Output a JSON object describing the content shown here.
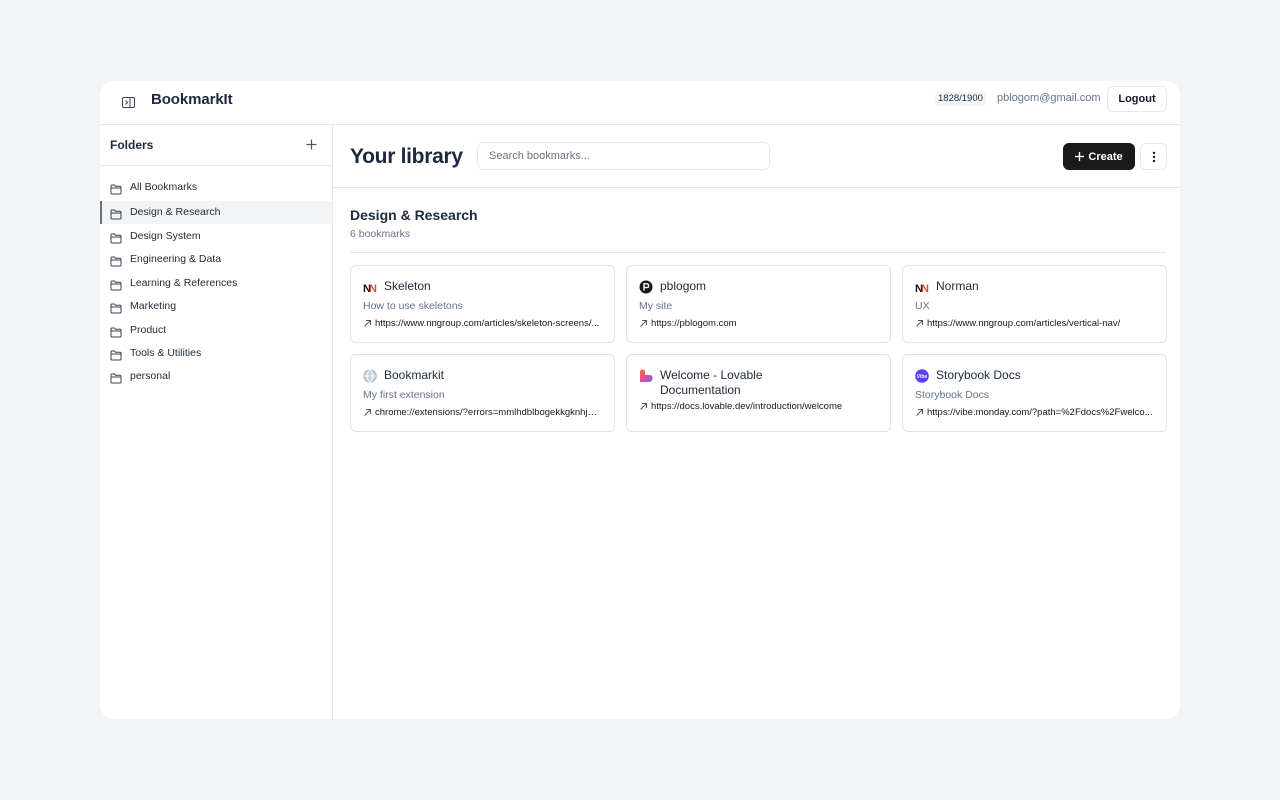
{
  "header": {
    "app_title": "BookmarkIt",
    "quota": "1828/1900",
    "email": "pblogom@gmail.com",
    "logout_label": "Logout"
  },
  "sidebar": {
    "title": "Folders",
    "items": [
      {
        "label": "All Bookmarks",
        "icon": "folder-icon"
      },
      {
        "label": "Design & Research",
        "icon": "folder-icon",
        "active": true
      },
      {
        "label": "Design System",
        "icon": "folder-icon"
      },
      {
        "label": "Engineering & Data",
        "icon": "folder-icon"
      },
      {
        "label": "Learning & References",
        "icon": "folder-icon"
      },
      {
        "label": "Marketing",
        "icon": "folder-icon"
      },
      {
        "label": "Product",
        "icon": "folder-icon"
      },
      {
        "label": "Tools & Utilities",
        "icon": "folder-icon"
      },
      {
        "label": "personal",
        "icon": "folder-icon"
      }
    ]
  },
  "main": {
    "title": "Your library",
    "search_placeholder": "Search bookmarks...",
    "create_label": "Create",
    "section_title": "Design & Research",
    "section_count": "6 bookmarks",
    "cards": [
      {
        "title": "Skeleton",
        "description": "How to use skeletons",
        "url": "https://www.nngroup.com/articles/skeleton-screens/...",
        "favicon": "nn-logo-icon"
      },
      {
        "title": "pblogom",
        "description": "My site",
        "url": "https://pblogom.com",
        "favicon": "p-logo-icon"
      },
      {
        "title": "Norman",
        "description": "UX",
        "url": "https://www.nngroup.com/articles/vertical-nav/",
        "favicon": "nn-logo-icon"
      },
      {
        "title": "Bookmarkit",
        "description": "My first extension",
        "url": "chrome://extensions/?errors=mmlhdblbogekkgknhjm...",
        "favicon": "globe-icon"
      },
      {
        "title": "Welcome - Lovable Documentation",
        "description": "",
        "url": "https://docs.lovable.dev/introduction/welcome",
        "favicon": "lovable-heart-icon"
      },
      {
        "title": "Storybook Docs",
        "description": "Storybook Docs",
        "url": "https://vibe.monday.com/?path=%2Fdocs%2Fwelco...",
        "favicon": "vibe-logo-icon"
      }
    ]
  },
  "colors": {
    "accent_dark": "#1a1a1a",
    "text_primary": "#1e293b",
    "text_muted": "#64748b",
    "border": "#e5e7eb",
    "page_bg": "#f3f4f6"
  }
}
